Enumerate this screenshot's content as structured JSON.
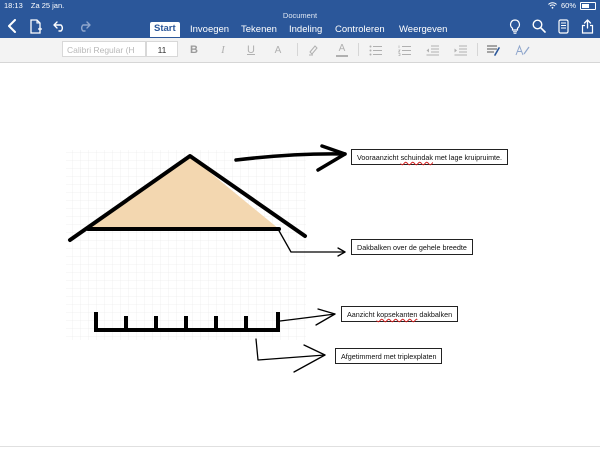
{
  "status_bar": {
    "time": "18:13",
    "date": "Za 25 jan.",
    "battery": "60%",
    "battery_level": 0.6
  },
  "app": {
    "document_title": "Document"
  },
  "toolbar_icons": [
    "back-chevron-icon",
    "document-icon",
    "undo-icon",
    "redo-icon",
    "lightbulb-icon",
    "search-icon",
    "phone-icon",
    "share-icon"
  ],
  "tabs": [
    {
      "label": "Start",
      "active": true
    },
    {
      "label": "Invoegen",
      "active": false
    },
    {
      "label": "Tekenen",
      "active": false
    },
    {
      "label": "Indeling",
      "active": false
    },
    {
      "label": "Controleren",
      "active": false
    },
    {
      "label": "Weergeven",
      "active": false
    }
  ],
  "ribbon": {
    "font_name": "Calibri Regular (H",
    "font_size": "11",
    "bold": "B",
    "italic": "I",
    "underline": "U",
    "text_effects": "A",
    "font_color": "A"
  },
  "callouts": {
    "c1_pre": "Vooraanzicht ",
    "c1_spell": "schuindak",
    "c1_post": " met lage kruipruimte.",
    "c2": "Dakbalken over de gehele breedte",
    "c3_pre": "Aanzicht ",
    "c3_spell": "kopsekanten",
    "c3_post": " dakbalken",
    "c4": "Afgetimmerd met triplexplaten"
  },
  "colors": {
    "ribbon_blue": "#2b579a",
    "roof_fill": "#f3d7b0",
    "spelling_underline": "#d21f1f"
  }
}
